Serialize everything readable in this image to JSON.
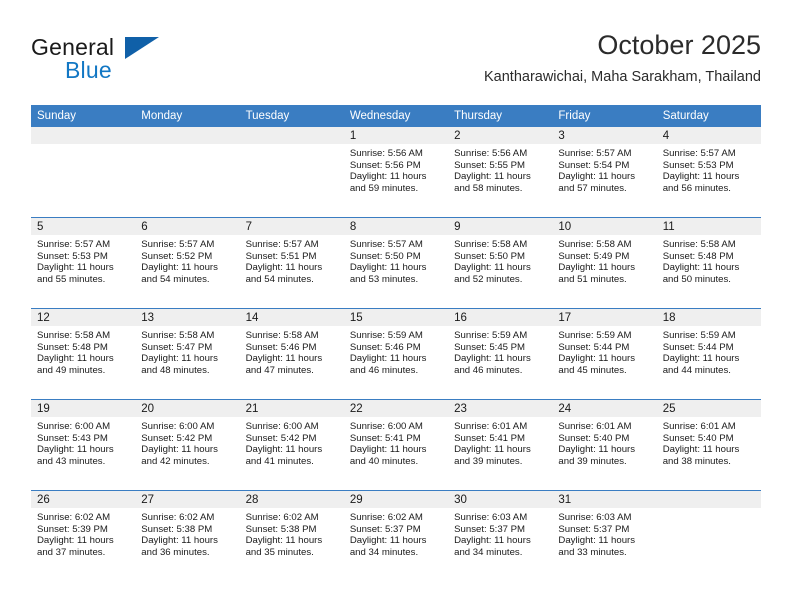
{
  "brand": {
    "name_top": "General",
    "name_bottom": "Blue",
    "triangle_icon": "triangle-logo-icon"
  },
  "header": {
    "title": "October 2025",
    "subtitle": "Kantharawichai, Maha Sarakham, Thailand"
  },
  "weekday_headers": [
    "Sunday",
    "Monday",
    "Tuesday",
    "Wednesday",
    "Thursday",
    "Friday",
    "Saturday"
  ],
  "labels": {
    "sunrise_prefix": "Sunrise: ",
    "sunset_prefix": "Sunset: ",
    "daylight_prefix": "Daylight: "
  },
  "colors": {
    "header_blue": "#3a7dc2",
    "brand_blue": "#1277c4",
    "triangle_blue": "#1060a8",
    "daynum_strip": "#efefef",
    "text": "#1a1a1a"
  },
  "weeks": [
    [
      {
        "empty": true
      },
      {
        "empty": true
      },
      {
        "empty": true
      },
      {
        "day": "1",
        "sunrise": "Sunrise: 5:56 AM",
        "sunset": "Sunset: 5:56 PM",
        "daylight_l1": "Daylight: 11 hours",
        "daylight_l2": "and 59 minutes."
      },
      {
        "day": "2",
        "sunrise": "Sunrise: 5:56 AM",
        "sunset": "Sunset: 5:55 PM",
        "daylight_l1": "Daylight: 11 hours",
        "daylight_l2": "and 58 minutes."
      },
      {
        "day": "3",
        "sunrise": "Sunrise: 5:57 AM",
        "sunset": "Sunset: 5:54 PM",
        "daylight_l1": "Daylight: 11 hours",
        "daylight_l2": "and 57 minutes."
      },
      {
        "day": "4",
        "sunrise": "Sunrise: 5:57 AM",
        "sunset": "Sunset: 5:53 PM",
        "daylight_l1": "Daylight: 11 hours",
        "daylight_l2": "and 56 minutes."
      }
    ],
    [
      {
        "day": "5",
        "sunrise": "Sunrise: 5:57 AM",
        "sunset": "Sunset: 5:53 PM",
        "daylight_l1": "Daylight: 11 hours",
        "daylight_l2": "and 55 minutes."
      },
      {
        "day": "6",
        "sunrise": "Sunrise: 5:57 AM",
        "sunset": "Sunset: 5:52 PM",
        "daylight_l1": "Daylight: 11 hours",
        "daylight_l2": "and 54 minutes."
      },
      {
        "day": "7",
        "sunrise": "Sunrise: 5:57 AM",
        "sunset": "Sunset: 5:51 PM",
        "daylight_l1": "Daylight: 11 hours",
        "daylight_l2": "and 54 minutes."
      },
      {
        "day": "8",
        "sunrise": "Sunrise: 5:57 AM",
        "sunset": "Sunset: 5:50 PM",
        "daylight_l1": "Daylight: 11 hours",
        "daylight_l2": "and 53 minutes."
      },
      {
        "day": "9",
        "sunrise": "Sunrise: 5:58 AM",
        "sunset": "Sunset: 5:50 PM",
        "daylight_l1": "Daylight: 11 hours",
        "daylight_l2": "and 52 minutes."
      },
      {
        "day": "10",
        "sunrise": "Sunrise: 5:58 AM",
        "sunset": "Sunset: 5:49 PM",
        "daylight_l1": "Daylight: 11 hours",
        "daylight_l2": "and 51 minutes."
      },
      {
        "day": "11",
        "sunrise": "Sunrise: 5:58 AM",
        "sunset": "Sunset: 5:48 PM",
        "daylight_l1": "Daylight: 11 hours",
        "daylight_l2": "and 50 minutes."
      }
    ],
    [
      {
        "day": "12",
        "sunrise": "Sunrise: 5:58 AM",
        "sunset": "Sunset: 5:48 PM",
        "daylight_l1": "Daylight: 11 hours",
        "daylight_l2": "and 49 minutes."
      },
      {
        "day": "13",
        "sunrise": "Sunrise: 5:58 AM",
        "sunset": "Sunset: 5:47 PM",
        "daylight_l1": "Daylight: 11 hours",
        "daylight_l2": "and 48 minutes."
      },
      {
        "day": "14",
        "sunrise": "Sunrise: 5:58 AM",
        "sunset": "Sunset: 5:46 PM",
        "daylight_l1": "Daylight: 11 hours",
        "daylight_l2": "and 47 minutes."
      },
      {
        "day": "15",
        "sunrise": "Sunrise: 5:59 AM",
        "sunset": "Sunset: 5:46 PM",
        "daylight_l1": "Daylight: 11 hours",
        "daylight_l2": "and 46 minutes."
      },
      {
        "day": "16",
        "sunrise": "Sunrise: 5:59 AM",
        "sunset": "Sunset: 5:45 PM",
        "daylight_l1": "Daylight: 11 hours",
        "daylight_l2": "and 46 minutes."
      },
      {
        "day": "17",
        "sunrise": "Sunrise: 5:59 AM",
        "sunset": "Sunset: 5:44 PM",
        "daylight_l1": "Daylight: 11 hours",
        "daylight_l2": "and 45 minutes."
      },
      {
        "day": "18",
        "sunrise": "Sunrise: 5:59 AM",
        "sunset": "Sunset: 5:44 PM",
        "daylight_l1": "Daylight: 11 hours",
        "daylight_l2": "and 44 minutes."
      }
    ],
    [
      {
        "day": "19",
        "sunrise": "Sunrise: 6:00 AM",
        "sunset": "Sunset: 5:43 PM",
        "daylight_l1": "Daylight: 11 hours",
        "daylight_l2": "and 43 minutes."
      },
      {
        "day": "20",
        "sunrise": "Sunrise: 6:00 AM",
        "sunset": "Sunset: 5:42 PM",
        "daylight_l1": "Daylight: 11 hours",
        "daylight_l2": "and 42 minutes."
      },
      {
        "day": "21",
        "sunrise": "Sunrise: 6:00 AM",
        "sunset": "Sunset: 5:42 PM",
        "daylight_l1": "Daylight: 11 hours",
        "daylight_l2": "and 41 minutes."
      },
      {
        "day": "22",
        "sunrise": "Sunrise: 6:00 AM",
        "sunset": "Sunset: 5:41 PM",
        "daylight_l1": "Daylight: 11 hours",
        "daylight_l2": "and 40 minutes."
      },
      {
        "day": "23",
        "sunrise": "Sunrise: 6:01 AM",
        "sunset": "Sunset: 5:41 PM",
        "daylight_l1": "Daylight: 11 hours",
        "daylight_l2": "and 39 minutes."
      },
      {
        "day": "24",
        "sunrise": "Sunrise: 6:01 AM",
        "sunset": "Sunset: 5:40 PM",
        "daylight_l1": "Daylight: 11 hours",
        "daylight_l2": "and 39 minutes."
      },
      {
        "day": "25",
        "sunrise": "Sunrise: 6:01 AM",
        "sunset": "Sunset: 5:40 PM",
        "daylight_l1": "Daylight: 11 hours",
        "daylight_l2": "and 38 minutes."
      }
    ],
    [
      {
        "day": "26",
        "sunrise": "Sunrise: 6:02 AM",
        "sunset": "Sunset: 5:39 PM",
        "daylight_l1": "Daylight: 11 hours",
        "daylight_l2": "and 37 minutes."
      },
      {
        "day": "27",
        "sunrise": "Sunrise: 6:02 AM",
        "sunset": "Sunset: 5:38 PM",
        "daylight_l1": "Daylight: 11 hours",
        "daylight_l2": "and 36 minutes."
      },
      {
        "day": "28",
        "sunrise": "Sunrise: 6:02 AM",
        "sunset": "Sunset: 5:38 PM",
        "daylight_l1": "Daylight: 11 hours",
        "daylight_l2": "and 35 minutes."
      },
      {
        "day": "29",
        "sunrise": "Sunrise: 6:02 AM",
        "sunset": "Sunset: 5:37 PM",
        "daylight_l1": "Daylight: 11 hours",
        "daylight_l2": "and 34 minutes."
      },
      {
        "day": "30",
        "sunrise": "Sunrise: 6:03 AM",
        "sunset": "Sunset: 5:37 PM",
        "daylight_l1": "Daylight: 11 hours",
        "daylight_l2": "and 34 minutes."
      },
      {
        "day": "31",
        "sunrise": "Sunrise: 6:03 AM",
        "sunset": "Sunset: 5:37 PM",
        "daylight_l1": "Daylight: 11 hours",
        "daylight_l2": "and 33 minutes."
      },
      {
        "empty": true
      }
    ]
  ]
}
